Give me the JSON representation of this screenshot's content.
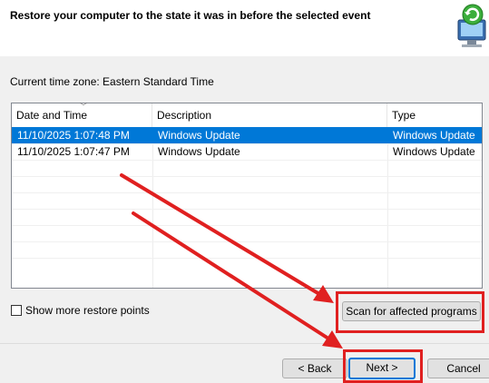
{
  "header": {
    "title": "Restore your computer to the state it was in before the selected event",
    "icon": "system-restore-icon"
  },
  "timezone_label": "Current time zone: Eastern Standard Time",
  "table": {
    "columns": [
      "Date and Time",
      "Description",
      "Type"
    ],
    "rows": [
      {
        "date": "11/10/2025 1:07:48 PM",
        "description": "Windows Update",
        "type": "Windows Update",
        "selected": true
      },
      {
        "date": "11/10/2025 1:07:47 PM",
        "description": "Windows Update",
        "type": "Windows Update",
        "selected": false
      }
    ]
  },
  "show_more_label": "Show more restore points",
  "scan_button_label": "Scan for affected programs",
  "back_button_label": "< Back",
  "next_button_label": "Next >",
  "cancel_button_label": "Cancel",
  "colors": {
    "selection": "#0078d7",
    "annotation": "#e02020"
  }
}
